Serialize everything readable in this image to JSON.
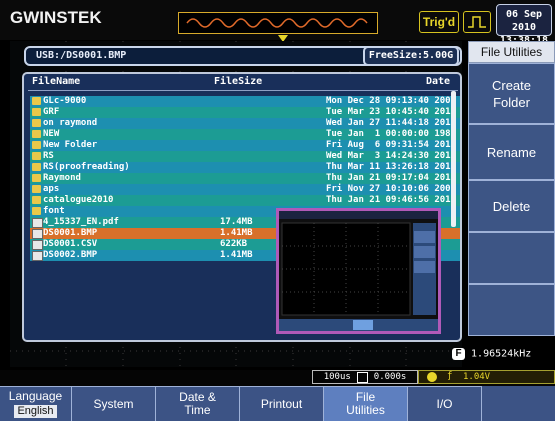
{
  "header": {
    "logo": "GWINSTEK",
    "trig_status": "Trig'd",
    "date": "06 Sep 2010",
    "time": "13:38:18"
  },
  "file_browser": {
    "path": "USB:/DS0001.BMP",
    "free_size": "FreeSize:5.00G",
    "columns": {
      "name": "FileName",
      "size": "FileSize",
      "date": "Date"
    },
    "rows": [
      {
        "type": "folder",
        "name": "GLc-9000",
        "size": "",
        "date": "Mon Dec 28 09:13:40 2009",
        "highlight": "#1d8fb0"
      },
      {
        "type": "folder",
        "name": "GRF",
        "size": "",
        "date": "Tue Mar 23 10:45:40 2010",
        "highlight": "#1c9c94"
      },
      {
        "type": "folder",
        "name": "on raymond",
        "size": "",
        "date": "Wed Jan 27 11:44:18 2010",
        "highlight": "#1d8fb0"
      },
      {
        "type": "folder",
        "name": "NEW",
        "size": "",
        "date": "Tue Jan  1 00:00:00 1980",
        "highlight": "#1c9c94"
      },
      {
        "type": "folder",
        "name": "New Folder",
        "size": "",
        "date": "Fri Aug  6 09:31:54 2010",
        "highlight": "#1d8fb0"
      },
      {
        "type": "folder",
        "name": "RS",
        "size": "",
        "date": "Wed Mar  3 14:24:30 2010",
        "highlight": "#1c9c94"
      },
      {
        "type": "folder",
        "name": "RS(proofreading)",
        "size": "",
        "date": "Thu Mar 11 13:26:18 2010",
        "highlight": "#1d8fb0"
      },
      {
        "type": "folder",
        "name": "Raymond",
        "size": "",
        "date": "Thu Jan 21 09:17:04 2010",
        "highlight": "#1c9c94"
      },
      {
        "type": "folder",
        "name": "aps",
        "size": "",
        "date": "Fri Nov 27 10:10:06 2009",
        "highlight": "#1d8fb0"
      },
      {
        "type": "folder",
        "name": "catalogue2010",
        "size": "",
        "date": "Thu Jan 21 09:46:56 2010",
        "highlight": "#1c9c94"
      },
      {
        "type": "folder",
        "name": "font",
        "size": "",
        "date": "",
        "highlight": "#1d8fb0"
      },
      {
        "type": "file",
        "name": "4_15337_EN.pdf",
        "size": "17.4MB",
        "date": "",
        "highlight": "#1c9c94"
      },
      {
        "type": "file",
        "name": "DS0001.BMP",
        "size": "1.41MB",
        "date": "",
        "highlight": "#d8702a"
      },
      {
        "type": "file",
        "name": "DS0001.CSV",
        "size": "622KB",
        "date": "",
        "highlight": "#1c9c94"
      },
      {
        "type": "file",
        "name": "DS0002.BMP",
        "size": "1.41MB",
        "date": "",
        "highlight": "#1d8fb0"
      }
    ]
  },
  "softkeys": {
    "title": "File Utilities",
    "create_folder": [
      "Create",
      "Folder"
    ],
    "rename": "Rename",
    "delete": "Delete"
  },
  "status": {
    "frequency": "1.96524kHz",
    "timebase": "100us",
    "offset": "0.000s",
    "trigger_level": "1.04V"
  },
  "bottom_menu": {
    "language_label": "Language",
    "language_value": "English",
    "system": "System",
    "date_time": [
      "Date &",
      "Time"
    ],
    "printout": "Printout",
    "file_utilities": [
      "File",
      "Utilities"
    ],
    "io": "I/O"
  },
  "colors": {
    "menu_blue": "#3c5385",
    "selected": "#5e7fbf",
    "accent_yellow": "#e8d62a",
    "thumbnail_border": "#b05ab8"
  }
}
